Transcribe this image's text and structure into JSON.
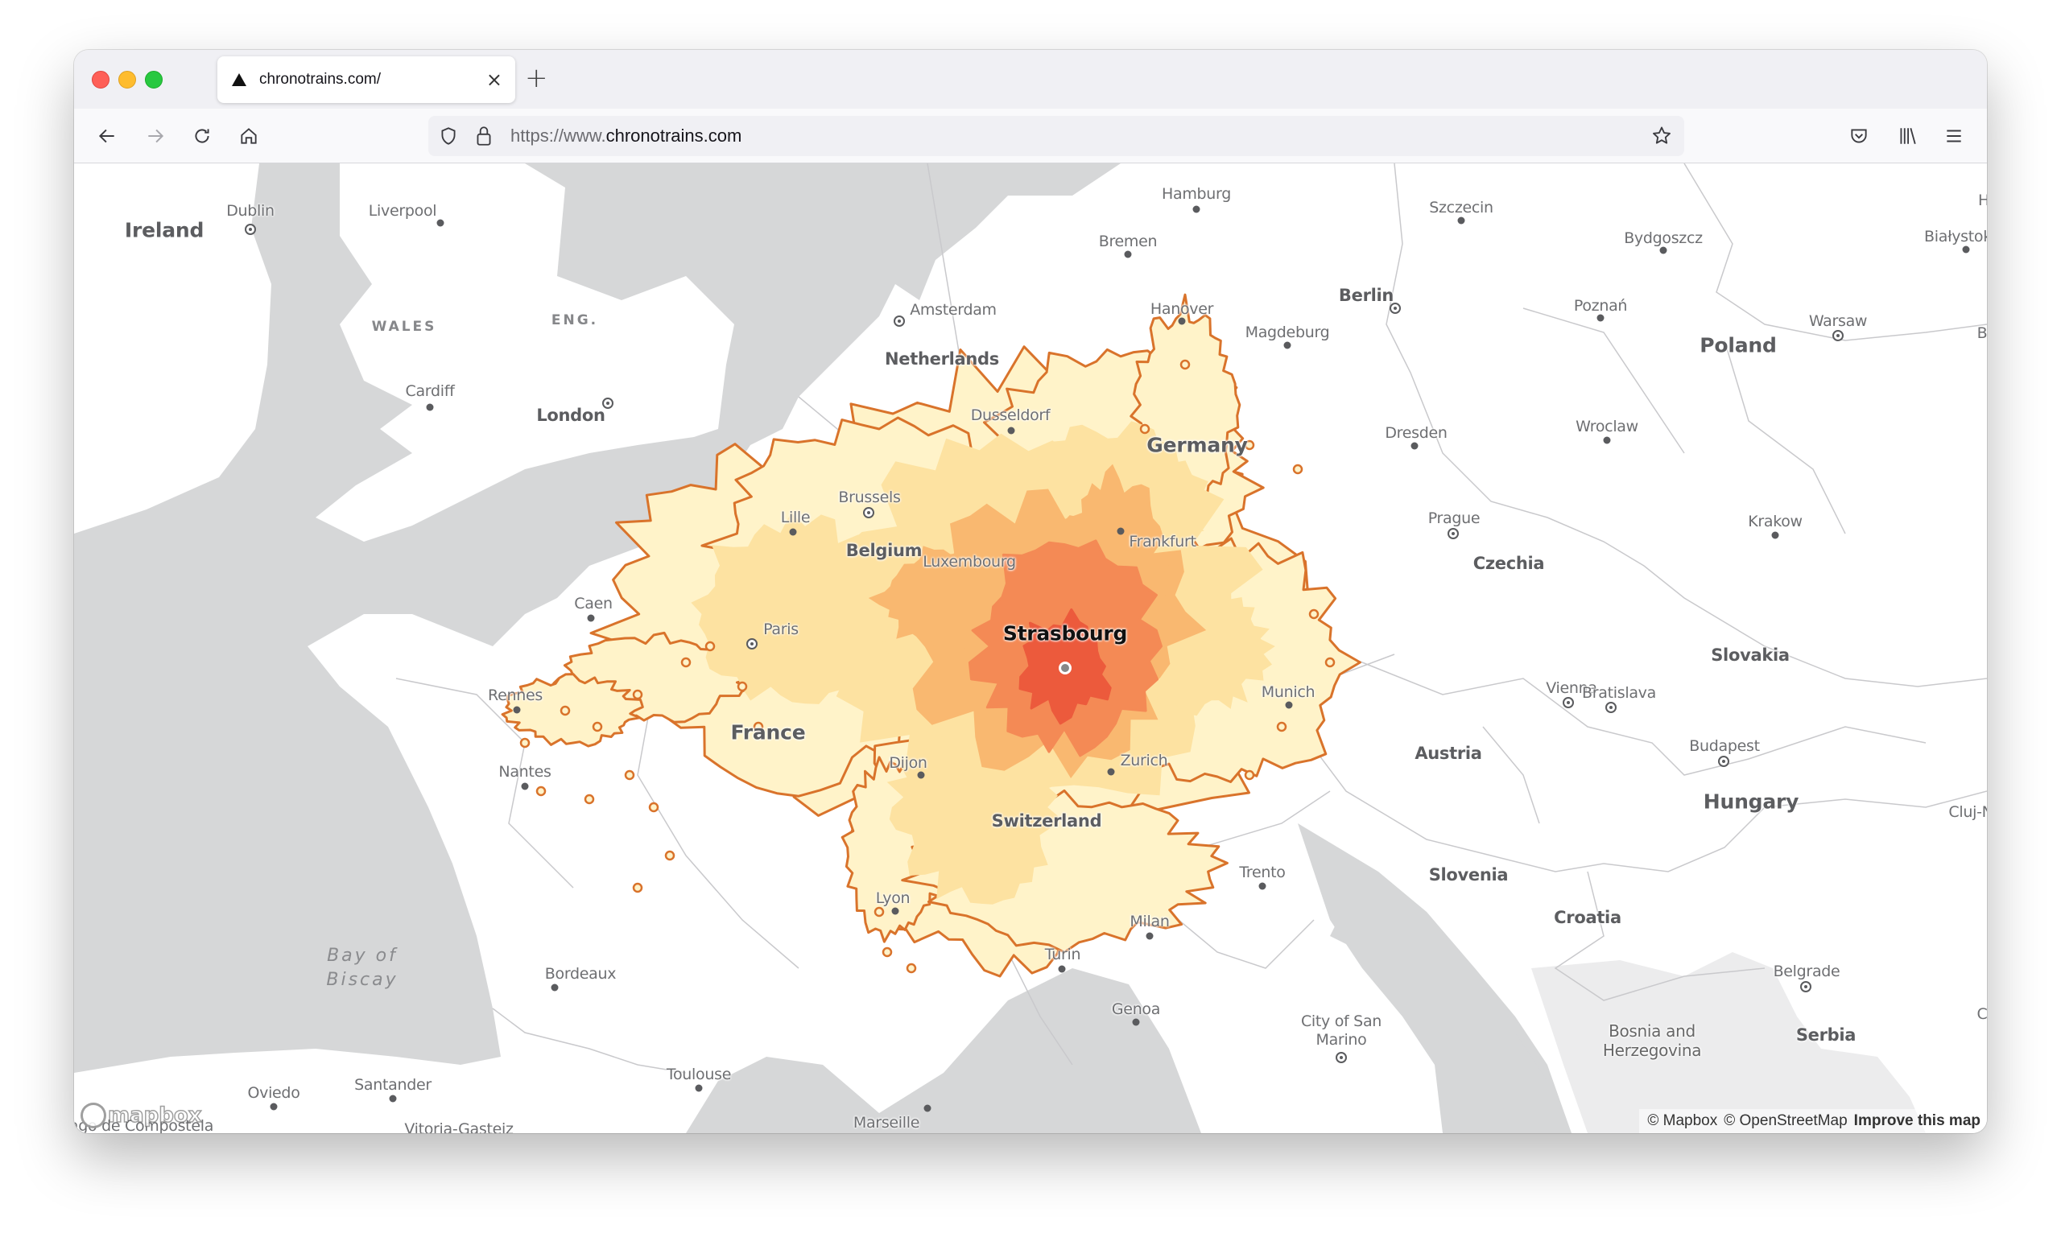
{
  "browser": {
    "tab": {
      "title": "chronotrains.com/",
      "icon": "triangle-favicon-icon",
      "close_icon": "×"
    },
    "new_tab_icon": "+",
    "url": {
      "protocol": "https://www.",
      "host": "chronotrains.com"
    },
    "toolbar_icons": [
      "back-arrow-icon",
      "forward-arrow-icon",
      "reload-icon",
      "home-icon",
      "shield-icon",
      "lock-icon",
      "bookmark-star-icon",
      "pocket-icon",
      "library-icon",
      "menu-icon"
    ]
  },
  "map": {
    "focus_city": "Strasbourg",
    "isochrone_colors": {
      "outline": "#d9732b",
      "outer": "#fff3c9",
      "mid": "#fde2a1",
      "inner": "#f9b870",
      "core": "#f48a55",
      "center": "#ec5a3c"
    },
    "countries": [
      "Ireland",
      "Netherlands",
      "Belgium",
      "Germany",
      "France",
      "Switzerland",
      "Czechia",
      "Poland",
      "Austria",
      "Slovakia",
      "Hungary",
      "Slovenia",
      "Croatia",
      "Bosnia and Herzegovina",
      "Serbia"
    ],
    "regions": [
      "WALES",
      "ENG."
    ],
    "seas": [
      "Bay of Biscay"
    ],
    "cities": [
      "Dublin",
      "Liverpool",
      "Cardiff",
      "London",
      "Amsterdam",
      "Hamburg",
      "Bremen",
      "Hanover",
      "Berlin",
      "Magdeburg",
      "Szczecin",
      "Bydgoszcz",
      "Poznań",
      "Warsaw",
      "Białystok",
      "Dusseldorf",
      "Brussels",
      "Lille",
      "Dresden",
      "Wroclaw",
      "Prague",
      "Krakow",
      "Frankfurt",
      "Luxembourg",
      "Caen",
      "Paris",
      "Rennes",
      "Nantes",
      "Dijon",
      "Zurich",
      "Munich",
      "Vienna",
      "Bratislava",
      "Budapest",
      "Cluj-N",
      "Trento",
      "Milan",
      "Turin",
      "Lyon",
      "Genoa",
      "Bordeaux",
      "Toulouse",
      "Marseille",
      "City of San Marino",
      "Belgrade",
      "Oviedo",
      "Santander",
      "Vitoria-Gasteiz",
      "Santiago de Compostela"
    ],
    "edge_labels": [
      "H",
      "B",
      "C"
    ],
    "attribution": {
      "mapbox": "© Mapbox",
      "osm": "© OpenStreetMap",
      "improve": "Improve this map"
    },
    "logo": "mapbox"
  }
}
